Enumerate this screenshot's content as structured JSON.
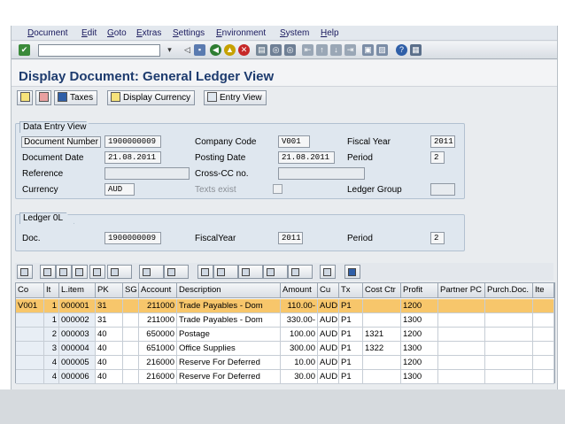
{
  "menu": [
    "Document",
    "Edit",
    "Goto",
    "Extras",
    "Settings",
    "Environment",
    "System",
    "Help"
  ],
  "title": "Display Document: General Ledger View",
  "app_toolbar": {
    "taxes": "Taxes",
    "display_currency": "Display Currency",
    "entry_view": "Entry View"
  },
  "data_entry": {
    "group_title": "Data Entry View",
    "document_number": {
      "label": "Document Number",
      "value": "1900000009"
    },
    "company_code": {
      "label": "Company Code",
      "value": "V001"
    },
    "fiscal_year": {
      "label": "Fiscal Year",
      "value": "2011"
    },
    "document_date": {
      "label": "Document Date",
      "value": "21.08.2011"
    },
    "posting_date": {
      "label": "Posting Date",
      "value": "21.08.2011"
    },
    "period": {
      "label": "Period",
      "value": "2"
    },
    "reference": {
      "label": "Reference",
      "value": ""
    },
    "cross_cc": {
      "label": "Cross-CC no.",
      "value": ""
    },
    "currency": {
      "label": "Currency",
      "value": "AUD"
    },
    "texts_exist": {
      "label": "Texts exist"
    },
    "ledger_group": {
      "label": "Ledger Group",
      "value": ""
    }
  },
  "ledger": {
    "group_title": "Ledger 0L",
    "doc": {
      "label": "Doc.",
      "value": "1900000009"
    },
    "fiscal_year": {
      "label": "FiscalYear",
      "value": "2011"
    },
    "period": {
      "label": "Period",
      "value": "2"
    }
  },
  "grid": {
    "headers": [
      "Co",
      "It",
      "L.item",
      "PK",
      "SG",
      "Account",
      "Description",
      "Amount",
      "Cu",
      "Tx",
      "Cost Ctr",
      "Profit",
      "Partner PC",
      "Purch.Doc.",
      "Ite"
    ],
    "rows": [
      [
        "V001",
        "1",
        "000001",
        "31",
        "",
        "211000",
        "Trade Payables - Dom",
        "110.00-",
        "AUD",
        "P1",
        "",
        "1200",
        "",
        "",
        ""
      ],
      [
        "",
        "1",
        "000002",
        "31",
        "",
        "211000",
        "Trade Payables - Dom",
        "330.00-",
        "AUD",
        "P1",
        "",
        "1300",
        "",
        "",
        ""
      ],
      [
        "",
        "2",
        "000003",
        "40",
        "",
        "650000",
        "Postage",
        "100.00",
        "AUD",
        "P1",
        "1321",
        "1200",
        "",
        "",
        ""
      ],
      [
        "",
        "3",
        "000004",
        "40",
        "",
        "651000",
        "Office Supplies",
        "300.00",
        "AUD",
        "P1",
        "1322",
        "1300",
        "",
        "",
        ""
      ],
      [
        "",
        "4",
        "000005",
        "40",
        "",
        "216000",
        "Reserve For Deferred",
        "10.00",
        "AUD",
        "P1",
        "",
        "1200",
        "",
        "",
        ""
      ],
      [
        "",
        "4",
        "000006",
        "40",
        "",
        "216000",
        "Reserve For Deferred",
        "30.00",
        "AUD",
        "P1",
        "",
        "1300",
        "",
        "",
        ""
      ]
    ]
  }
}
